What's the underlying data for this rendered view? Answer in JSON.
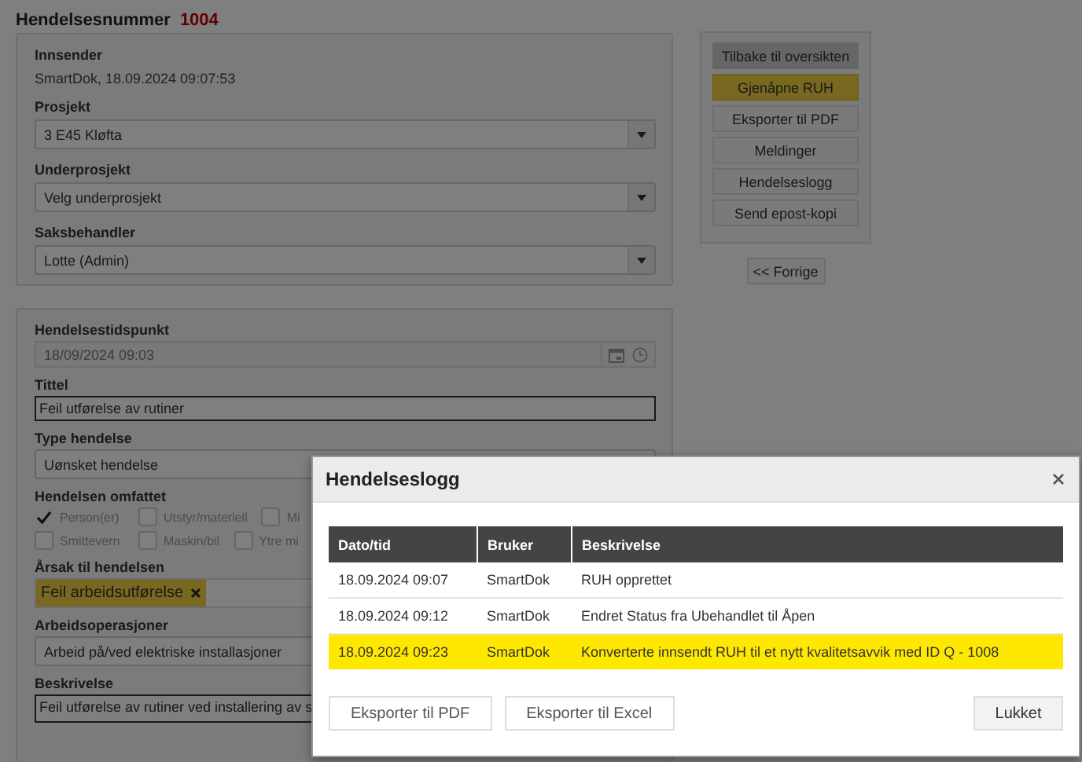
{
  "header": {
    "label": "Hendelsesnummer",
    "number": "1004"
  },
  "submitter": {
    "label": "Innsender",
    "value": "SmartDok, 18.09.2024 09:07:53"
  },
  "selects": [
    {
      "label": "Prosjekt",
      "value": "3 E45 Kløfta"
    },
    {
      "label": "Underprosjekt",
      "value": "Velg underprosjekt"
    },
    {
      "label": "Saksbehandler",
      "value": "Lotte (Admin)"
    }
  ],
  "actions": [
    {
      "label": "Tilbake til oversikten",
      "kind": "muted"
    },
    {
      "label": "Gjenåpne RUH",
      "kind": "primary"
    },
    {
      "label": "Eksporter til PDF",
      "kind": "default"
    },
    {
      "label": "Meldinger",
      "kind": "default"
    },
    {
      "label": "Hendelseslogg",
      "kind": "default"
    },
    {
      "label": "Send epost-kopi",
      "kind": "default"
    }
  ],
  "prev_button": "<< Forrige",
  "event": {
    "time": {
      "label": "Hendelsestidspunkt",
      "value": "18/09/2024 09:03"
    },
    "title": {
      "label": "Tittel",
      "value": "Feil utførelse av rutiner"
    },
    "type": {
      "label": "Type hendelse",
      "value": "Uønsket hendelse"
    },
    "scope": {
      "label": "Hendelsen omfattet",
      "options": [
        {
          "label": "Person(er)",
          "checked": true
        },
        {
          "label": "Utstyr/materiell",
          "checked": false
        },
        {
          "label": "Mi",
          "checked": false
        },
        {
          "label": "Smittevern",
          "checked": false
        },
        {
          "label": "Maskin/bil",
          "checked": false
        },
        {
          "label": "Ytre mi",
          "checked": false
        }
      ]
    },
    "cause": {
      "label": "Årsak til hendelsen",
      "tags": [
        "Feil arbeidsutførelse"
      ]
    },
    "operations": {
      "label": "Arbeidsoperasjoner",
      "value": "Arbeid på/ved elektriske installasjoner"
    },
    "description": {
      "label": "Beskrivelse",
      "value": "Feil utførelse av rutiner ved installering av s"
    }
  },
  "modal": {
    "title": "Hendelseslogg",
    "columns": [
      "Dato/tid",
      "Bruker",
      "Beskrivelse"
    ],
    "rows": [
      {
        "cells": [
          "18.09.2024 09:07",
          "SmartDok",
          "RUH opprettet"
        ],
        "highlighted": false
      },
      {
        "cells": [
          "18.09.2024 09:12",
          "SmartDok",
          "Endret Status fra Ubehandlet til Åpen"
        ],
        "highlighted": false
      },
      {
        "cells": [
          "18.09.2024 09:23",
          "SmartDok",
          "Konverterte innsendt RUH til et nytt kvalitetsavvik med ID Q - 1008"
        ],
        "highlighted": true
      }
    ],
    "buttons": [
      "Eksporter til PDF",
      "Eksporter til Excel"
    ],
    "close_button": "Lukket"
  }
}
